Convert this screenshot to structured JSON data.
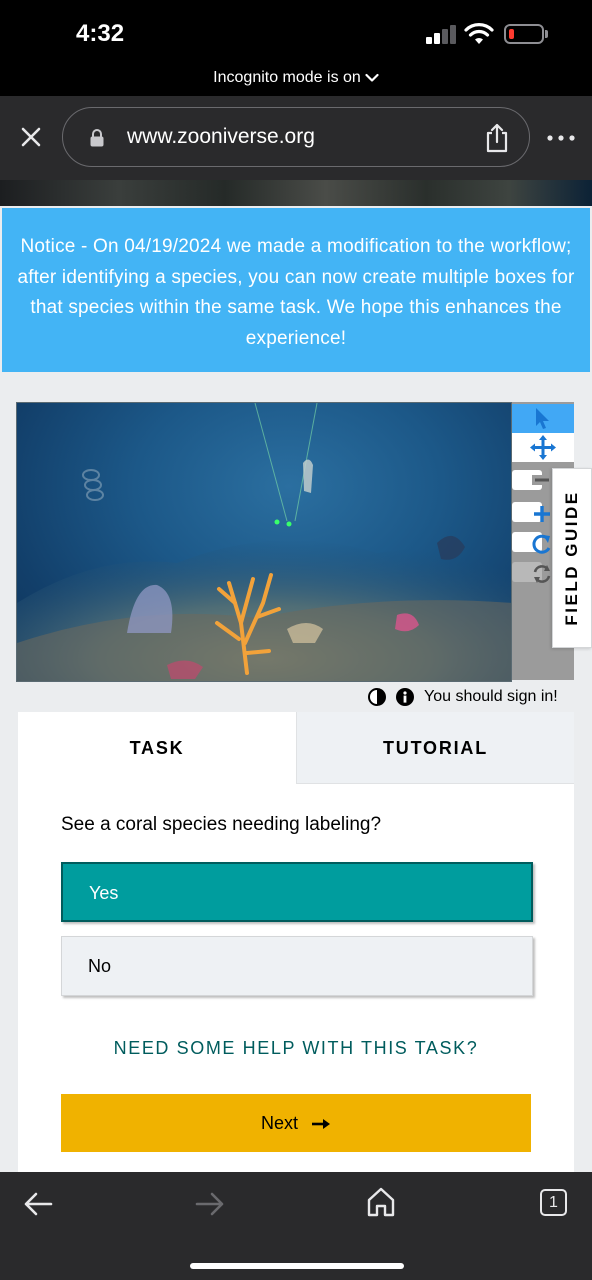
{
  "status_bar": {
    "time": "4:32",
    "icons": [
      "cellular-signal-icon",
      "wifi-icon",
      "battery-low-icon"
    ],
    "battery_color": "#ff3b30"
  },
  "incognito_banner": {
    "label": "Incognito mode is on"
  },
  "browser": {
    "url": "www.zooniverse.org",
    "icons": [
      "close-icon",
      "lock-icon",
      "share-icon",
      "more-icon"
    ]
  },
  "notice": {
    "text": "Notice - On 04/19/2024 we made a modification to the workflow; after identifying a species, you can now create multiple boxes for that species within the same task. We hope this enhances the experience!",
    "background": "#43b4f5"
  },
  "viewer": {
    "tools": [
      "annotate-pointer-icon",
      "move-icon",
      "zoom-out-icon",
      "zoom-in-icon",
      "rotate-icon",
      "reset-icon"
    ],
    "field_guide_label": "FIELD GUIDE"
  },
  "signin": {
    "text": "You should sign in!",
    "icons": [
      "contrast-icon",
      "info-icon"
    ]
  },
  "task_panel": {
    "tabs": [
      {
        "label": "TASK",
        "active": true
      },
      {
        "label": "TUTORIAL",
        "active": false
      }
    ],
    "question": "See a coral species needing labeling?",
    "answers": [
      {
        "label": "Yes",
        "selected": true
      },
      {
        "label": "No",
        "selected": false
      }
    ],
    "help_link": "NEED SOME HELP WITH THIS TASK?",
    "next_label": "Next",
    "colors": {
      "selected": "#009d9e",
      "next": "#f0b200",
      "link": "#005c5d"
    }
  },
  "bottom_bar": {
    "tab_count": "1",
    "icons": [
      "back-arrow-icon",
      "forward-arrow-icon",
      "home-icon",
      "tabs-icon"
    ]
  }
}
